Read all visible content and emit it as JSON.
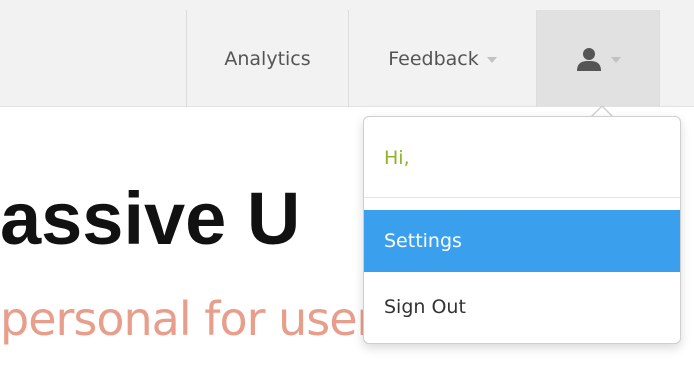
{
  "navbar": {
    "items": [
      {
        "label": "Analytics"
      },
      {
        "label": "Feedback"
      }
    ],
    "user_menu_icon": "user-icon"
  },
  "hero": {
    "title": "assive U",
    "subtitle": "personal for users."
  },
  "dropdown": {
    "greeting": "Hi,",
    "items": [
      {
        "label": "Settings",
        "active": true
      },
      {
        "label": "Sign Out",
        "active": false
      }
    ]
  },
  "colors": {
    "navbar_bg": "#f2f2f2",
    "active_item": "#3aa0ee",
    "greeting": "#8fb42a",
    "subtitle": "#e79f8c"
  }
}
